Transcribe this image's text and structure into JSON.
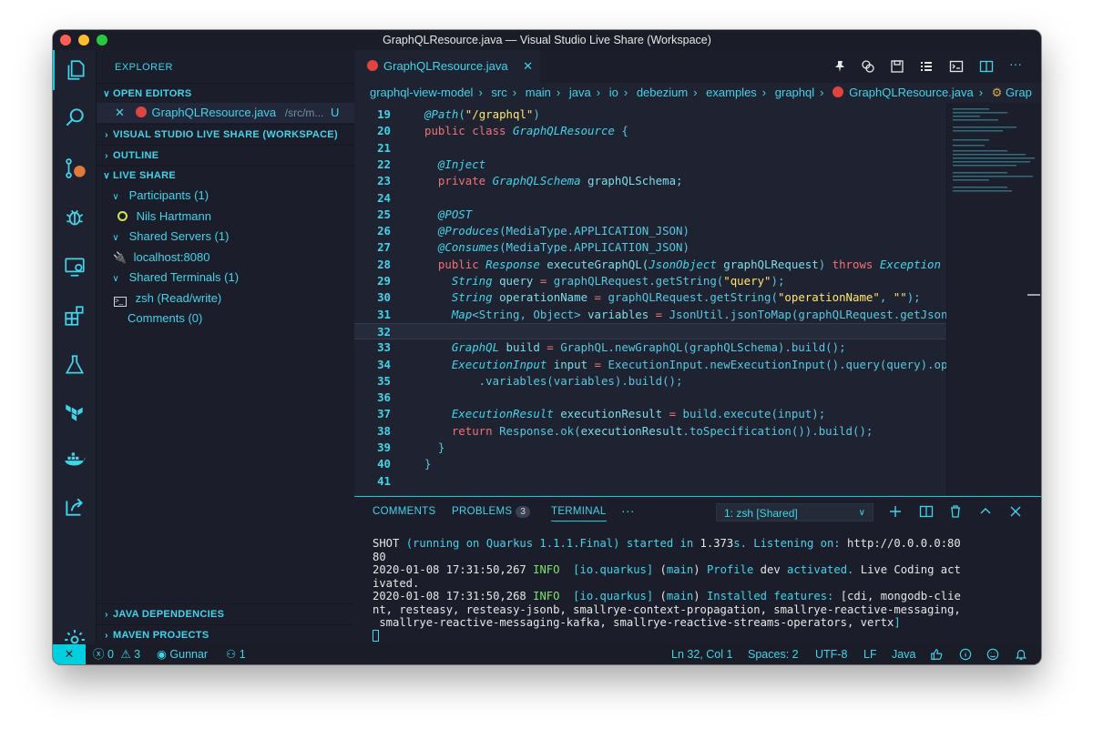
{
  "window": {
    "title": "GraphQLResource.java — Visual Studio Live Share (Workspace)"
  },
  "activity_bar": [
    "files-icon",
    "search-icon",
    "source-control-icon",
    "debug-icon",
    "remote-explorer-icon",
    "extensions-icon",
    "test-flask-icon",
    "terraform-icon",
    "docker-icon",
    "live-share-icon",
    "settings-gear-icon"
  ],
  "sidebar": {
    "title": "EXPLORER",
    "open_editors": {
      "header": "OPEN EDITORS",
      "file_name": "GraphQLResource.java",
      "file_path": "/src/m...",
      "file_status": "U"
    },
    "workspace_header": "VISUAL STUDIO LIVE SHARE (WORKSPACE)",
    "outline_header": "OUTLINE",
    "live_share": {
      "header": "LIVE SHARE",
      "participants": "Participants (1)",
      "participant_name": "Nils Hartmann",
      "shared_servers": "Shared Servers (1)",
      "server": "localhost:8080",
      "shared_terminals": "Shared Terminals (1)",
      "terminal": "zsh (Read/write)",
      "comments": "Comments (0)"
    },
    "java_dependencies": "JAVA DEPENDENCIES",
    "maven_projects": "MAVEN PROJECTS"
  },
  "editor": {
    "tab_label": "GraphQLResource.java",
    "breadcrumb": [
      "graphql-view-model",
      "src",
      "main",
      "java",
      "io",
      "debezium",
      "examples",
      "graphql",
      "GraphQLResource.java",
      "Grap"
    ],
    "lines": [
      {
        "n": "19",
        "tokens": [
          [
            "ann",
            "@Path"
          ],
          [
            "plain",
            "("
          ],
          [
            "str",
            "\"/graphql\""
          ],
          [
            "plain",
            ")"
          ]
        ]
      },
      {
        "n": "20",
        "tokens": [
          [
            "kw",
            "public class "
          ],
          [
            "type",
            "GraphQLResource"
          ],
          [
            "plain",
            " {"
          ]
        ]
      },
      {
        "n": "21",
        "tokens": []
      },
      {
        "n": "22",
        "tokens": [
          [
            "plain",
            "  "
          ],
          [
            "ann",
            "@Inject"
          ]
        ]
      },
      {
        "n": "23",
        "tokens": [
          [
            "plain",
            "  "
          ],
          [
            "kw",
            "private "
          ],
          [
            "type",
            "GraphQLSchema"
          ],
          [
            "var",
            " graphQLSchema;"
          ]
        ]
      },
      {
        "n": "24",
        "tokens": []
      },
      {
        "n": "25",
        "tokens": [
          [
            "plain",
            "  "
          ],
          [
            "ann",
            "@POST"
          ]
        ]
      },
      {
        "n": "26",
        "tokens": [
          [
            "plain",
            "  "
          ],
          [
            "ann",
            "@Produces"
          ],
          [
            "plain",
            "(MediaType.APPLICATION_JSON)"
          ]
        ]
      },
      {
        "n": "27",
        "tokens": [
          [
            "plain",
            "  "
          ],
          [
            "ann",
            "@Consumes"
          ],
          [
            "plain",
            "(MediaType.APPLICATION_JSON)"
          ]
        ]
      },
      {
        "n": "28",
        "tokens": [
          [
            "plain",
            "  "
          ],
          [
            "kw",
            "public "
          ],
          [
            "type",
            "Response"
          ],
          [
            "var",
            " executeGraphQL("
          ],
          [
            "type",
            "JsonObject"
          ],
          [
            "var",
            " graphQLRequest"
          ],
          [
            "plain",
            ") "
          ],
          [
            "kw",
            "throws "
          ],
          [
            "type",
            "Exception"
          ],
          [
            "plain",
            " {"
          ]
        ]
      },
      {
        "n": "29",
        "tokens": [
          [
            "plain",
            "    "
          ],
          [
            "type",
            "String"
          ],
          [
            "var",
            " query"
          ],
          [
            "kw",
            " = "
          ],
          [
            "plain",
            "graphQLRequest.getString("
          ],
          [
            "str",
            "\"query\""
          ],
          [
            "plain",
            ");"
          ]
        ]
      },
      {
        "n": "30",
        "tokens": [
          [
            "plain",
            "    "
          ],
          [
            "type",
            "String"
          ],
          [
            "var",
            " operationName"
          ],
          [
            "kw",
            " = "
          ],
          [
            "plain",
            "graphQLRequest.getString("
          ],
          [
            "str",
            "\"operationName\""
          ],
          [
            "plain",
            ", "
          ],
          [
            "str",
            "\"\""
          ],
          [
            "plain",
            ");"
          ]
        ]
      },
      {
        "n": "31",
        "tokens": [
          [
            "plain",
            "    "
          ],
          [
            "type",
            "Map"
          ],
          [
            "plain",
            "<String, Object> "
          ],
          [
            "var",
            "variables"
          ],
          [
            "kw",
            " = "
          ],
          [
            "plain",
            "JsonUtil.jsonToMap(graphQLRequest.getJsonO"
          ]
        ]
      },
      {
        "n": "32",
        "tokens": []
      },
      {
        "n": "33",
        "tokens": [
          [
            "plain",
            "    "
          ],
          [
            "type",
            "GraphQL"
          ],
          [
            "var",
            " build"
          ],
          [
            "kw",
            " = "
          ],
          [
            "plain",
            "GraphQL.newGraphQL(graphQLSchema).build();"
          ]
        ]
      },
      {
        "n": "34",
        "tokens": [
          [
            "plain",
            "    "
          ],
          [
            "type",
            "ExecutionInput"
          ],
          [
            "var",
            " input"
          ],
          [
            "kw",
            " = "
          ],
          [
            "plain",
            "ExecutionInput.newExecutionInput().query(query).ope"
          ]
        ]
      },
      {
        "n": "35",
        "tokens": [
          [
            "plain",
            "        .variables(variables).build();"
          ]
        ]
      },
      {
        "n": "36",
        "tokens": []
      },
      {
        "n": "37",
        "tokens": [
          [
            "plain",
            "    "
          ],
          [
            "type",
            "ExecutionResult"
          ],
          [
            "var",
            " executionResult"
          ],
          [
            "kw",
            " = "
          ],
          [
            "plain",
            "build.execute(input);"
          ]
        ]
      },
      {
        "n": "38",
        "tokens": [
          [
            "plain",
            "    "
          ],
          [
            "kw",
            "return "
          ],
          [
            "plain",
            "Response.ok("
          ],
          [
            "var",
            "executionResult"
          ],
          [
            "plain",
            ".toSpecification()).build();"
          ]
        ]
      },
      {
        "n": "39",
        "tokens": [
          [
            "plain",
            "  }"
          ]
        ]
      },
      {
        "n": "40",
        "tokens": [
          [
            "plain",
            "}"
          ]
        ]
      },
      {
        "n": "41",
        "tokens": []
      }
    ]
  },
  "panel": {
    "tabs": [
      "COMMENTS",
      "PROBLEMS",
      "TERMINAL"
    ],
    "problems_count": "3",
    "more": "···",
    "terminal_select": "1: zsh [Shared]",
    "terminal_lines": [
      [
        [
          "w",
          "SHOT "
        ],
        [
          "c",
          "(running on Quarkus 1.1.1.Final) started in "
        ],
        [
          "w",
          "1.373"
        ],
        [
          "c",
          "s. Listening on: "
        ],
        [
          "w",
          "http://0.0.0.0:80"
        ]
      ],
      [
        [
          "w",
          "80"
        ]
      ],
      [
        [
          "w",
          "2020-01-08 17:31:50,267 "
        ],
        [
          "g",
          "INFO"
        ],
        [
          "w",
          "  "
        ],
        [
          "c",
          "[io.quarkus]"
        ],
        [
          "w",
          " ("
        ],
        [
          "c",
          "main"
        ],
        [
          "w",
          ") "
        ],
        [
          "c",
          "Profile "
        ],
        [
          "w",
          "dev "
        ],
        [
          "c",
          "activated."
        ],
        [
          "w",
          " Live Coding act"
        ]
      ],
      [
        [
          "w",
          "ivated."
        ]
      ],
      [
        [
          "w",
          "2020-01-08 17:31:50,268 "
        ],
        [
          "g",
          "INFO"
        ],
        [
          "w",
          "  "
        ],
        [
          "c",
          "[io.quarkus]"
        ],
        [
          "w",
          " ("
        ],
        [
          "c",
          "main"
        ],
        [
          "w",
          ") "
        ],
        [
          "c",
          "Installed features: "
        ],
        [
          "w",
          "[cdi, mongodb-clie"
        ]
      ],
      [
        [
          "w",
          "nt, resteasy, resteasy-jsonb, smallrye-context-propagation, smallrye-reactive-messaging,"
        ]
      ],
      [
        [
          "w",
          " smallrye-reactive-messaging-kafka, smallrye-reactive-streams-operators, vertx"
        ],
        [
          "c",
          "]"
        ]
      ]
    ]
  },
  "status_bar": {
    "remote": "✕",
    "errors": "0",
    "warnings": "3",
    "user": "Gunnar",
    "participants": "1",
    "position": "Ln 32, Col 1",
    "spaces": "Spaces: 2",
    "encoding": "UTF-8",
    "eol": "LF",
    "language": "Java"
  },
  "colors": {
    "accent": "#00d4e6",
    "background": "#1f2331",
    "keyword": "#f07178",
    "string": "#ffe66d"
  }
}
